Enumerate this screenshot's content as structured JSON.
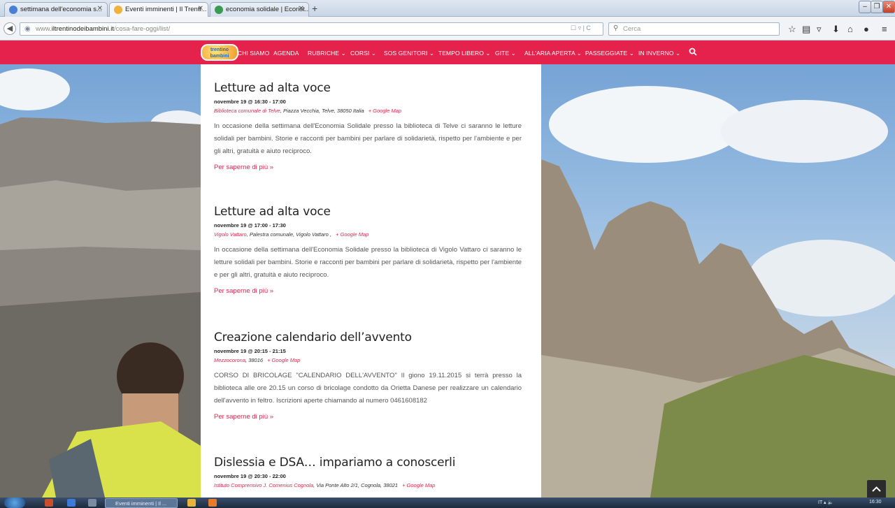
{
  "browser": {
    "tabs": [
      {
        "label": "settimana dell'economia s...",
        "favicon_color": "#4a7fd6",
        "icon": "google-icon"
      },
      {
        "label": "Eventi imminenti | Il Trenti...",
        "favicon_color": "#f0b23a",
        "icon": "site-icon"
      },
      {
        "label": "economia solidale | Ecorist...",
        "favicon_color": "#3a9a52",
        "icon": "ecorist-icon"
      }
    ],
    "new_tab": "+",
    "url_prefix": "www.",
    "url_domain": "iltrentinodeibambini.it",
    "url_path": "/cosa-fare-oggi/list/",
    "url_tools": "☐ ▿ | C",
    "search_placeholder": "Cerca",
    "window_buttons": [
      "–",
      "❐",
      "✕"
    ]
  },
  "menu": {
    "logo_text": "trentino bambini",
    "items": [
      "CHI SIAMO",
      "AGENDA",
      "RUBRICHE ⌄",
      "CORSI ⌄",
      "SOS GENITORI ⌄",
      "TEMPO LIBERO ⌄",
      "GITE ⌄",
      "ALL'ARIA APERTA ⌄",
      "PASSEGGIATE ⌄",
      "IN INVERNO ⌄"
    ],
    "accent_color": "#e5224b"
  },
  "events": [
    {
      "title": "Letture ad alta voce",
      "date": "novembre 19 @ 16:30 - 17:00",
      "venue_link": "Biblioteca comunale di Telve",
      "venue_rest": ", Piazza Vecchia, Telve, 38050 Italia",
      "gmap": "+ Google Map",
      "description": "In occasione della settimana dell'Economia Solidale presso la biblioteca di Telve ci saranno le letture solidali per bambini. Storie e racconti per bambini per parlare di solidarietà, rispetto per l'ambiente e per gli altri, gratuità e aiuto reciproco.",
      "more": "Per saperne di più »"
    },
    {
      "title": "Letture ad alta voce",
      "date": "novembre 19 @ 17:00 - 17:30",
      "venue_link": "Vigolo Vattaro",
      "venue_rest": ", Palestra comunale, Vigolo Vattaro ,",
      "gmap": "+ Google Map",
      "description": "In occasione della settimana dell'Economia Solidale presso la biblioteca di Vigolo Vattaro ci saranno le letture solidali per bambini. Storie e racconti per bambini per parlare di solidarietà, rispetto per l'ambiente e per gli altri, gratuità e aiuto reciproco.",
      "more": "Per saperne di più »"
    },
    {
      "title": "Creazione calendario dell’avvento",
      "date": "novembre 19 @ 20:15 - 21:15",
      "venue_link": "Mezzocorona",
      "venue_rest": ", 38016",
      "gmap": "+ Google Map",
      "description": "CORSO DI BRICOLAGE \"CALENDARIO DELL'AVVENTO\" Il giono 19.11.2015 si terrà presso la biblioteca alle ore 20.15 un corso di bricolage condotto da Orietta Danese per realizzare un calendario dell'avvento in feltro. Iscrizioni aperte chiamando al numero 0461608182",
      "more": "Per saperne di più »"
    },
    {
      "title": "Dislessia e DSA… impariamo a conoscerli",
      "date": "novembre 19 @ 20:30 - 22:00",
      "venue_link": "Istituto Comprensivo J. Comenius Cognola",
      "venue_rest": ", Via Ponte Alto 2/1, Cognola, 38021",
      "gmap": "+ Google Map",
      "description": "",
      "more": ""
    }
  ],
  "taskbar": {
    "active_window": "Eventi imminenti | Il ...",
    "tray": "IT  ▴  🔈",
    "clock": "16:30"
  }
}
